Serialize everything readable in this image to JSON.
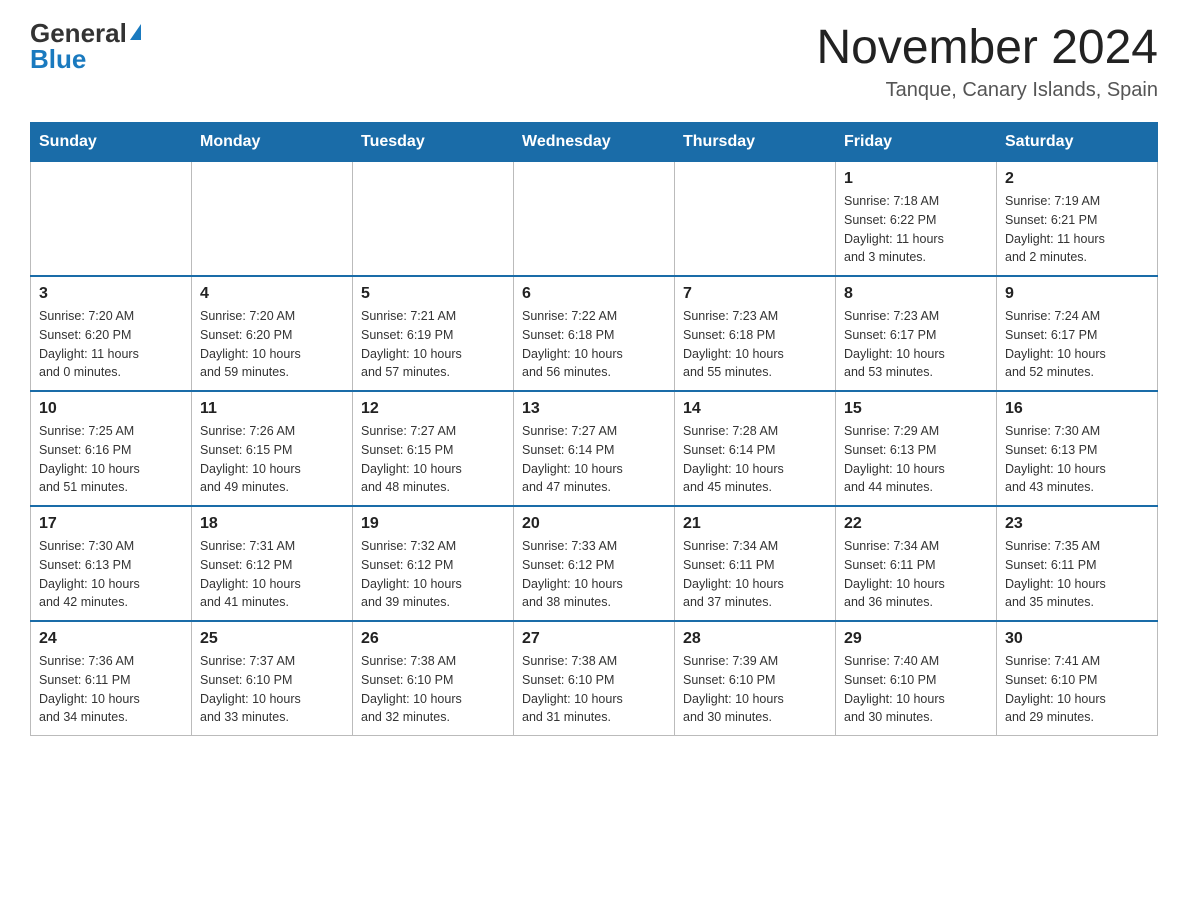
{
  "logo": {
    "general": "General",
    "blue": "Blue"
  },
  "title": "November 2024",
  "location": "Tanque, Canary Islands, Spain",
  "days_of_week": [
    "Sunday",
    "Monday",
    "Tuesday",
    "Wednesday",
    "Thursday",
    "Friday",
    "Saturday"
  ],
  "weeks": [
    [
      {
        "day": "",
        "info": ""
      },
      {
        "day": "",
        "info": ""
      },
      {
        "day": "",
        "info": ""
      },
      {
        "day": "",
        "info": ""
      },
      {
        "day": "",
        "info": ""
      },
      {
        "day": "1",
        "info": "Sunrise: 7:18 AM\nSunset: 6:22 PM\nDaylight: 11 hours\nand 3 minutes."
      },
      {
        "day": "2",
        "info": "Sunrise: 7:19 AM\nSunset: 6:21 PM\nDaylight: 11 hours\nand 2 minutes."
      }
    ],
    [
      {
        "day": "3",
        "info": "Sunrise: 7:20 AM\nSunset: 6:20 PM\nDaylight: 11 hours\nand 0 minutes."
      },
      {
        "day": "4",
        "info": "Sunrise: 7:20 AM\nSunset: 6:20 PM\nDaylight: 10 hours\nand 59 minutes."
      },
      {
        "day": "5",
        "info": "Sunrise: 7:21 AM\nSunset: 6:19 PM\nDaylight: 10 hours\nand 57 minutes."
      },
      {
        "day": "6",
        "info": "Sunrise: 7:22 AM\nSunset: 6:18 PM\nDaylight: 10 hours\nand 56 minutes."
      },
      {
        "day": "7",
        "info": "Sunrise: 7:23 AM\nSunset: 6:18 PM\nDaylight: 10 hours\nand 55 minutes."
      },
      {
        "day": "8",
        "info": "Sunrise: 7:23 AM\nSunset: 6:17 PM\nDaylight: 10 hours\nand 53 minutes."
      },
      {
        "day": "9",
        "info": "Sunrise: 7:24 AM\nSunset: 6:17 PM\nDaylight: 10 hours\nand 52 minutes."
      }
    ],
    [
      {
        "day": "10",
        "info": "Sunrise: 7:25 AM\nSunset: 6:16 PM\nDaylight: 10 hours\nand 51 minutes."
      },
      {
        "day": "11",
        "info": "Sunrise: 7:26 AM\nSunset: 6:15 PM\nDaylight: 10 hours\nand 49 minutes."
      },
      {
        "day": "12",
        "info": "Sunrise: 7:27 AM\nSunset: 6:15 PM\nDaylight: 10 hours\nand 48 minutes."
      },
      {
        "day": "13",
        "info": "Sunrise: 7:27 AM\nSunset: 6:14 PM\nDaylight: 10 hours\nand 47 minutes."
      },
      {
        "day": "14",
        "info": "Sunrise: 7:28 AM\nSunset: 6:14 PM\nDaylight: 10 hours\nand 45 minutes."
      },
      {
        "day": "15",
        "info": "Sunrise: 7:29 AM\nSunset: 6:13 PM\nDaylight: 10 hours\nand 44 minutes."
      },
      {
        "day": "16",
        "info": "Sunrise: 7:30 AM\nSunset: 6:13 PM\nDaylight: 10 hours\nand 43 minutes."
      }
    ],
    [
      {
        "day": "17",
        "info": "Sunrise: 7:30 AM\nSunset: 6:13 PM\nDaylight: 10 hours\nand 42 minutes."
      },
      {
        "day": "18",
        "info": "Sunrise: 7:31 AM\nSunset: 6:12 PM\nDaylight: 10 hours\nand 41 minutes."
      },
      {
        "day": "19",
        "info": "Sunrise: 7:32 AM\nSunset: 6:12 PM\nDaylight: 10 hours\nand 39 minutes."
      },
      {
        "day": "20",
        "info": "Sunrise: 7:33 AM\nSunset: 6:12 PM\nDaylight: 10 hours\nand 38 minutes."
      },
      {
        "day": "21",
        "info": "Sunrise: 7:34 AM\nSunset: 6:11 PM\nDaylight: 10 hours\nand 37 minutes."
      },
      {
        "day": "22",
        "info": "Sunrise: 7:34 AM\nSunset: 6:11 PM\nDaylight: 10 hours\nand 36 minutes."
      },
      {
        "day": "23",
        "info": "Sunrise: 7:35 AM\nSunset: 6:11 PM\nDaylight: 10 hours\nand 35 minutes."
      }
    ],
    [
      {
        "day": "24",
        "info": "Sunrise: 7:36 AM\nSunset: 6:11 PM\nDaylight: 10 hours\nand 34 minutes."
      },
      {
        "day": "25",
        "info": "Sunrise: 7:37 AM\nSunset: 6:10 PM\nDaylight: 10 hours\nand 33 minutes."
      },
      {
        "day": "26",
        "info": "Sunrise: 7:38 AM\nSunset: 6:10 PM\nDaylight: 10 hours\nand 32 minutes."
      },
      {
        "day": "27",
        "info": "Sunrise: 7:38 AM\nSunset: 6:10 PM\nDaylight: 10 hours\nand 31 minutes."
      },
      {
        "day": "28",
        "info": "Sunrise: 7:39 AM\nSunset: 6:10 PM\nDaylight: 10 hours\nand 30 minutes."
      },
      {
        "day": "29",
        "info": "Sunrise: 7:40 AM\nSunset: 6:10 PM\nDaylight: 10 hours\nand 30 minutes."
      },
      {
        "day": "30",
        "info": "Sunrise: 7:41 AM\nSunset: 6:10 PM\nDaylight: 10 hours\nand 29 minutes."
      }
    ]
  ]
}
